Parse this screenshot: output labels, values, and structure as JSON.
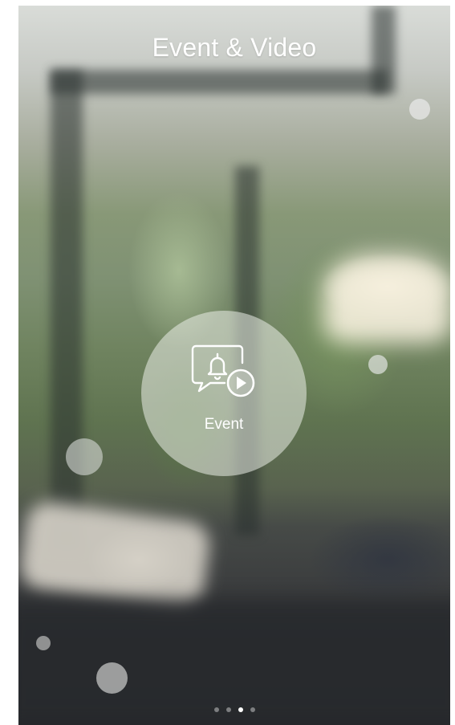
{
  "header": {
    "title": "Event & Video"
  },
  "feature": {
    "label": "Event",
    "icon": "event-bell-video-icon"
  },
  "pagination": {
    "count": 4,
    "active_index": 2
  },
  "background": {
    "description_icon": "living-room-background"
  }
}
